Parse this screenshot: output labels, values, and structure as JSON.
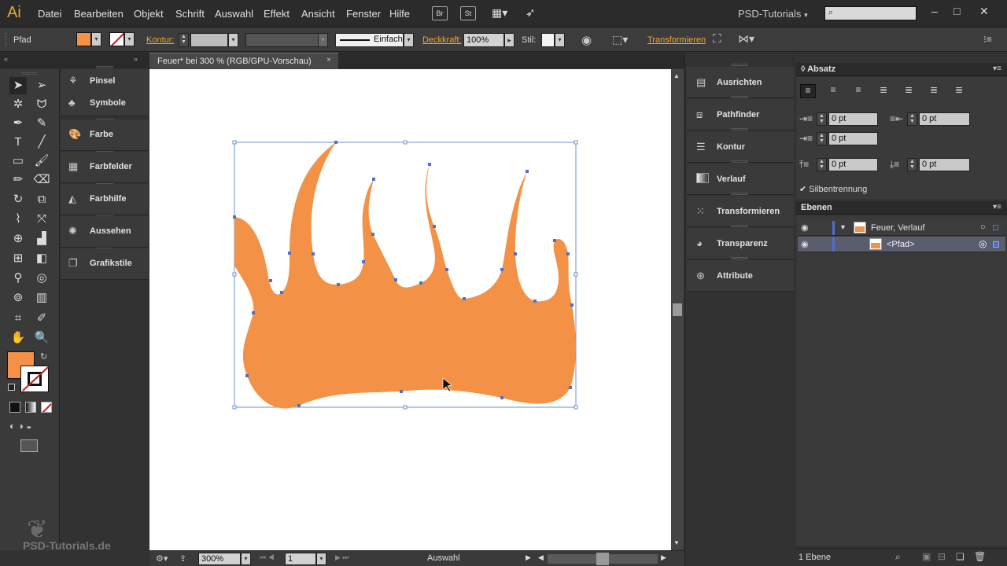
{
  "app": {
    "logo": "Ai",
    "workspace": "PSD-Tutorials",
    "search_placeholder": ""
  },
  "menu": [
    "Datei",
    "Bearbeiten",
    "Objekt",
    "Schrift",
    "Auswahl",
    "Effekt",
    "Ansicht",
    "Fenster",
    "Hilfe"
  ],
  "bridge_icons": [
    "Br",
    "St"
  ],
  "controlbar": {
    "selection": "Pfad",
    "kontur_label": "Kontur:",
    "stroke_style": "Einfach",
    "opacity_label": "Deckkraft:",
    "opacity_value": "100%",
    "style_label": "Stil:",
    "transform_link": "Transformieren"
  },
  "document": {
    "tab_title": "Feuer* bei 300 % (RGB/GPU-Vorschau)",
    "close": "×"
  },
  "left_dock": [
    {
      "label": "Pinsel",
      "icon": "brush-icon"
    },
    {
      "label": "Symbole",
      "icon": "symbols-icon"
    },
    {
      "label": "Farbe",
      "icon": "palette-icon"
    },
    {
      "label": "Farbfelder",
      "icon": "swatches-icon"
    },
    {
      "label": "Farbhilfe",
      "icon": "color-guide-icon"
    },
    {
      "label": "Aussehen",
      "icon": "appearance-icon"
    },
    {
      "label": "Grafikstile",
      "icon": "graphic-styles-icon"
    }
  ],
  "mid_dock": [
    {
      "label": "Ausrichten",
      "icon": "align-icon"
    },
    {
      "label": "Pathfinder",
      "icon": "pathfinder-icon"
    },
    {
      "label": "Kontur",
      "icon": "stroke-icon"
    },
    {
      "label": "Verlauf",
      "icon": "gradient-icon"
    },
    {
      "label": "Transformieren",
      "icon": "transform-icon"
    },
    {
      "label": "Transparenz",
      "icon": "transparency-icon"
    },
    {
      "label": "Attribute",
      "icon": "attributes-icon"
    }
  ],
  "absatz": {
    "title": "Absatz",
    "indent_left": "0 pt",
    "indent_right": "0 pt",
    "first_line": "0 pt",
    "space_before": "0 pt",
    "space_after": "0 pt",
    "hyphenation_label": "Silbentrennung",
    "hyphenation_checked": true
  },
  "ebenen": {
    "title": "Ebenen",
    "layers": [
      {
        "name": "Feuer, Verlauf"
      },
      {
        "name": "<Pfad>"
      }
    ],
    "footer": "1 Ebene"
  },
  "statusbar": {
    "zoom": "300%",
    "artboard": "1",
    "mode": "Auswahl"
  },
  "watermark": "PSD-Tutorials.de",
  "colors": {
    "fill": "#f39247",
    "accent": "#f0a535",
    "selection": "#4f6fc8"
  }
}
